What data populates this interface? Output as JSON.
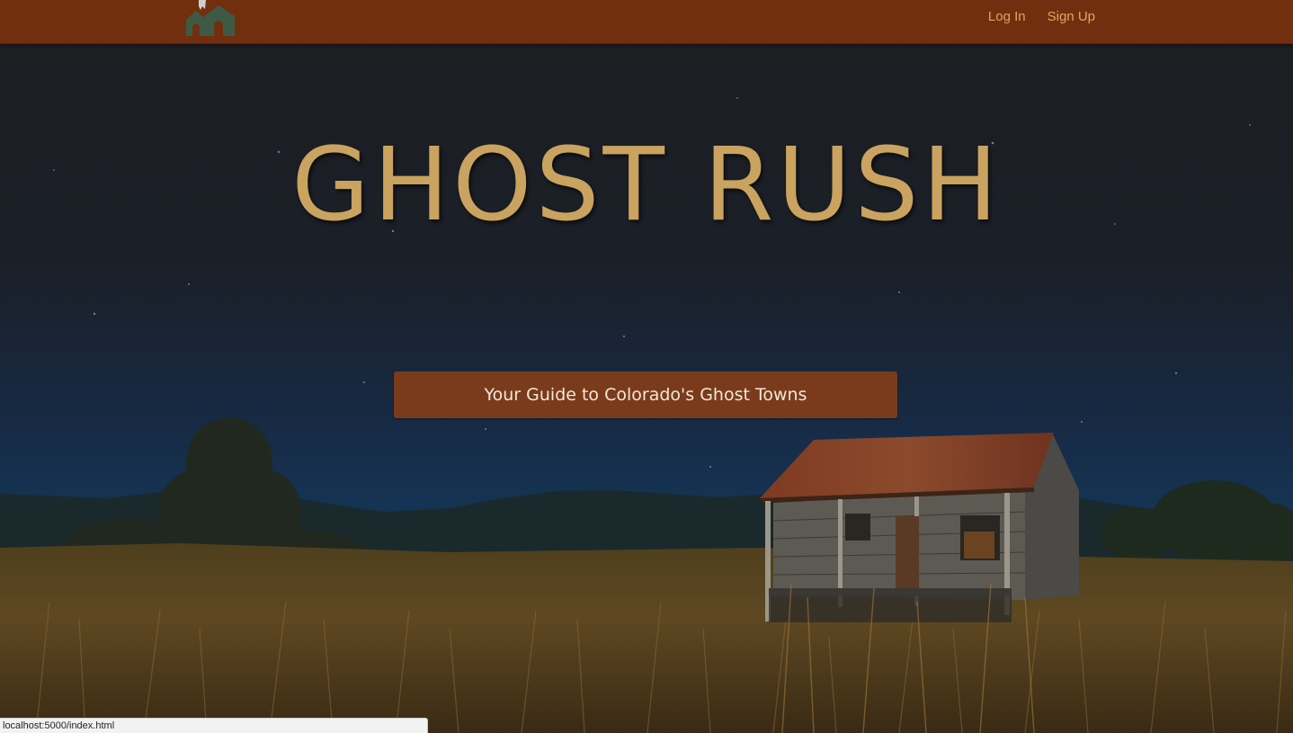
{
  "navbar": {
    "logo_icon": "ghost-town-logo-icon",
    "links": [
      {
        "label": "Log In"
      },
      {
        "label": "Sign Up"
      }
    ],
    "background": "#722f0f",
    "link_color": "#d9a85e"
  },
  "hero": {
    "title": "GHOST RUSH",
    "tagline_button": "Your Guide to Colorado's Ghost Towns",
    "title_color": "#c9a35f",
    "button_color": "#7a3b1c",
    "background_image": "abandoned-cabin-night-sky-image"
  },
  "status_bar": {
    "url": "localhost:5000/index.html"
  }
}
